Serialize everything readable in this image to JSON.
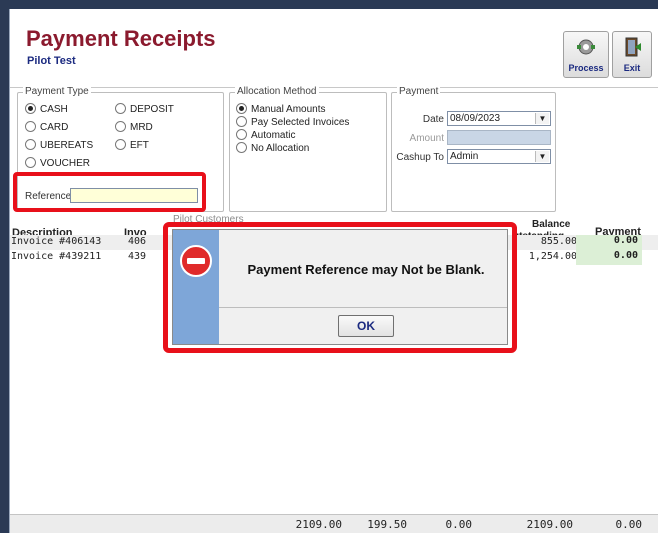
{
  "header": {
    "title": "Payment Receipts",
    "subtitle": "Pilot Test"
  },
  "toolbar": {
    "process_label": "Process",
    "exit_label": "Exit"
  },
  "payment_type": {
    "title": "Payment Type",
    "options": [
      "CASH",
      "DEPOSIT",
      "CARD",
      "MRD",
      "UBEREATS",
      "EFT",
      "VOUCHER"
    ],
    "selected": "CASH",
    "reference_label": "Reference",
    "reference_value": ""
  },
  "allocation": {
    "title": "Allocation Method",
    "options": [
      "Manual Amounts",
      "Pay Selected Invoices",
      "Automatic",
      "No Allocation"
    ],
    "selected": "Manual Amounts"
  },
  "payment": {
    "title": "Payment",
    "date_label": "Date",
    "date_value": "08/09/2023",
    "amount_label": "Amount",
    "amount_value": "",
    "cashup_label": "Cashup To",
    "cashup_value": "Admin"
  },
  "grid": {
    "col_description": "Description",
    "col_invoice": "Invo",
    "col_balance_1": "Balance",
    "col_balance_2": "utstanding",
    "col_payment": "Payment",
    "rows": [
      {
        "description": "Invoice #406143",
        "invoice": "406",
        "balance": "855.00",
        "payment": "0.00"
      },
      {
        "description": "Invoice #439211",
        "invoice": "439",
        "balance": "1,254.00",
        "payment": "0.00"
      }
    ],
    "totals": [
      "2109.00",
      "199.50",
      "0.00",
      "2109.00",
      "0.00"
    ]
  },
  "dialog": {
    "window_title": "Pilot Customers",
    "message": "Payment Reference may Not be Blank.",
    "ok_label": "OK"
  },
  "colors": {
    "highlight": "#e8101a",
    "title": "#8b1a2e",
    "accent": "#1b2a80"
  }
}
